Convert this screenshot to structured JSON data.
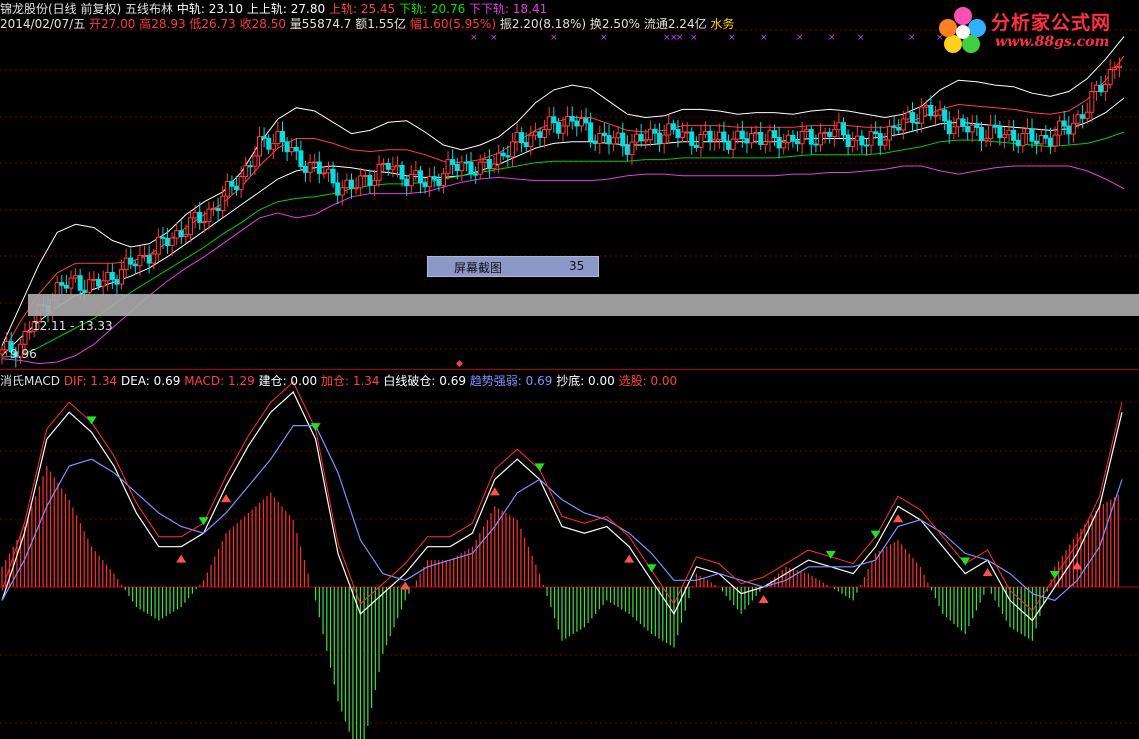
{
  "header": {
    "stock_name": "锦龙股份(日线 前复权)",
    "indicator": "五线布林",
    "mid_label": "中轨: 23.10",
    "upper_label": "上上轨: 27.80",
    "upper2_label": "上轨: 25.45",
    "lower_label": "下轨: 20.76",
    "lower2_label": "下下轨: 18.41"
  },
  "quote": {
    "date": "2014/02/07/五",
    "open": "开27.00",
    "high": "高28.93",
    "low": "低26.73",
    "close": "收28.50",
    "volume": "量55874.7",
    "amount": "额1.55亿",
    "change": "幅1.60(5.95%)",
    "amplitude": "振2.20(8.18%)",
    "turnover": "换2.50%",
    "float": "流通2.24亿",
    "sector": "水务"
  },
  "macd_header": {
    "name": "消氏MACD",
    "dif": "DIF: 1.34",
    "dea": "DEA: 0.69",
    "macd": "MACD: 1.29",
    "build": "建仓: 0.00",
    "add": "加仓: 1.34",
    "white_lock": "白线破仓: 0.69",
    "trend": "趋势强弱: 0.69",
    "bottom": "抄底: 0.00",
    "pick": "选股: 0.00"
  },
  "logo": {
    "title": "分析家公式网",
    "url": "www.88gs.com"
  },
  "tooltip": {
    "label": "屏幕截图",
    "value": "35"
  },
  "range_label": "12.11 - 13.33",
  "low_label": "9.96",
  "colors": {
    "up": "#ff3b3b",
    "down": "#00e0e0",
    "upper2": "#ffffff",
    "upper": "#ff4040",
    "mid": "#ffffff",
    "lower": "#00d000",
    "lower2": "#e040e0",
    "dif": "#ffffff",
    "dea": "#7f8fff",
    "bar_up": "#ff3030",
    "bar_down": "#40e040"
  },
  "chart_data": [
    {
      "type": "candlestick",
      "title": "五线布林",
      "ylim": [
        9.5,
        30
      ],
      "series": [
        {
          "name": "上上轨",
          "values": [
            10.5,
            13,
            15.5,
            17.5,
            18,
            17.8,
            17,
            16.6,
            16.8,
            17.5,
            18.6,
            19.4,
            20,
            21.2,
            23,
            24.5,
            25.2,
            25,
            24.3,
            23.6,
            23.8,
            24.3,
            24.4,
            23.7,
            22.9,
            22.6,
            22.9,
            23.4,
            24.3,
            25.5,
            26.3,
            26.6,
            26.4,
            25.6,
            24.8,
            24.6,
            24.7,
            25.1,
            25.1,
            25,
            24.8,
            24.9,
            24.9,
            24.8,
            25,
            25.1,
            25,
            24.8,
            24.6,
            24.8,
            25.3,
            26.3,
            26.9,
            26.8,
            26.6,
            26.5,
            26.1,
            25.9,
            26.2,
            27,
            28.2,
            29.6
          ]
        },
        {
          "name": "上轨",
          "values": [
            10,
            12,
            13.7,
            15,
            15.6,
            15.6,
            15.6,
            15.7,
            16.1,
            16.9,
            17.8,
            18.6,
            19.3,
            20.3,
            21.6,
            22.7,
            23.3,
            23.3,
            23,
            22.6,
            22.5,
            22.6,
            22.6,
            22.3,
            21.9,
            21.8,
            22,
            22.4,
            23.1,
            23.8,
            24.3,
            24.6,
            24.6,
            24.2,
            23.8,
            23.7,
            23.8,
            24.1,
            24.1,
            24.1,
            24,
            24,
            24,
            24,
            24.1,
            24.1,
            24.1,
            24,
            24,
            24.2,
            24.6,
            25.1,
            25.4,
            25.3,
            25.2,
            25.1,
            24.9,
            24.8,
            25,
            25.7,
            26.9,
            28.4
          ]
        },
        {
          "name": "中轨",
          "values": [
            9.9,
            11,
            12,
            12.9,
            13.6,
            14,
            14.4,
            14.8,
            15.3,
            16,
            16.8,
            17.6,
            18.4,
            19.2,
            20,
            20.8,
            21.3,
            21.5,
            21.6,
            21.5,
            21.3,
            21.2,
            21,
            20.9,
            20.9,
            21,
            21.3,
            21.7,
            22.2,
            22.7,
            23,
            23.1,
            23.1,
            23,
            22.9,
            22.9,
            23,
            23.1,
            23.1,
            23.1,
            23.1,
            23.1,
            23.1,
            23.2,
            23.3,
            23.3,
            23.3,
            23.3,
            23.4,
            23.6,
            23.9,
            24.2,
            24.3,
            24.2,
            24.1,
            24,
            23.9,
            23.8,
            23.9,
            24.3,
            24.9,
            25.8
          ]
        },
        {
          "name": "下轨",
          "values": [
            9.8,
            9.9,
            10.4,
            11,
            11.6,
            12.2,
            13,
            13.8,
            14.5,
            15.2,
            15.9,
            16.6,
            17.4,
            18.1,
            18.9,
            19.4,
            19.6,
            19.7,
            19.9,
            20.2,
            20.4,
            20.5,
            20.5,
            20.6,
            20.8,
            21,
            21.2,
            21.4,
            21.6,
            21.8,
            21.9,
            21.9,
            21.9,
            21.9,
            21.9,
            22,
            22,
            22.1,
            22.1,
            22.1,
            22.1,
            22.1,
            22.1,
            22.2,
            22.3,
            22.3,
            22.3,
            22.3,
            22.4,
            22.6,
            22.8,
            23.1,
            23.2,
            23.2,
            23.1,
            23,
            22.9,
            22.8,
            22.9,
            23,
            23.3,
            23.7
          ]
        },
        {
          "name": "下下轨",
          "values": [
            9.7,
            9.6,
            9.4,
            9.5,
            9.9,
            10.6,
            11.6,
            12.6,
            13.6,
            14.5,
            15.3,
            16,
            16.8,
            17.6,
            18.4,
            18.7,
            18.4,
            18.6,
            19.2,
            19.7,
            19.9,
            19.9,
            19.9,
            20,
            20.3,
            20.6,
            20.8,
            20.9,
            20.8,
            20.7,
            20.7,
            20.7,
            20.7,
            20.8,
            21,
            21.1,
            21.1,
            21,
            21,
            21,
            21,
            21,
            21,
            21.1,
            21.1,
            21.2,
            21.2,
            21.3,
            21.4,
            21.6,
            21.6,
            21.3,
            21.1,
            21.3,
            21.5,
            21.6,
            21.6,
            21.6,
            21.6,
            21.3,
            20.8,
            20.2
          ]
        }
      ],
      "candles_close": [
        10,
        10.6,
        12.5,
        14,
        14.5,
        14.2,
        14.8,
        15.5,
        16.2,
        17,
        17.8,
        18.5,
        19.6,
        21,
        22.8,
        23.5,
        22,
        21.6,
        20.6,
        20.2,
        21,
        21.6,
        21,
        20.5,
        21.2,
        21.8,
        21.3,
        22.2,
        23,
        23.6,
        24.1,
        24.5,
        23.6,
        23.2,
        23,
        23.3,
        23.8,
        23.5,
        23.2,
        23.4,
        23.1,
        23.6,
        23,
        23.4,
        23.2,
        23.8,
        23.4,
        23,
        23.6,
        24.2,
        25.1,
        24.6,
        24,
        23.8,
        23.6,
        23.5,
        23.2,
        23.4,
        24,
        25.2,
        27,
        28.5
      ]
    },
    {
      "type": "bar",
      "title": "消氏MACD",
      "ylim": [
        -2.9,
        2.9
      ],
      "series": [
        {
          "name": "DIF",
          "values": [
            -0.2,
            0.8,
            2.2,
            2.6,
            2.3,
            1.8,
            1.1,
            0.6,
            0.6,
            0.8,
            1.5,
            2.1,
            2.6,
            2.9,
            2.2,
            0.5,
            -0.4,
            -0.1,
            0.2,
            0.6,
            0.6,
            0.8,
            1.6,
            1.9,
            1.6,
            0.9,
            0.8,
            0.9,
            0.6,
            0.1,
            -0.4,
            0.3,
            0.2,
            -0.1,
            0,
            0.2,
            0.4,
            0.3,
            0.2,
            0.6,
            1.2,
            1.0,
            0.6,
            0.2,
            0.4,
            -0.2,
            -0.5,
            0,
            0.5,
            1.2,
            2.6
          ]
        },
        {
          "name": "DEA",
          "values": [
            -0.2,
            0.4,
            1.2,
            1.8,
            1.9,
            1.7,
            1.4,
            1.1,
            0.9,
            0.8,
            1.1,
            1.5,
            1.9,
            2.4,
            2.4,
            1.7,
            0.7,
            0.2,
            0.1,
            0.3,
            0.4,
            0.5,
            0.9,
            1.4,
            1.6,
            1.3,
            1.1,
            1.0,
            0.8,
            0.5,
            0.1,
            0.1,
            0.2,
            0.1,
            0,
            0.1,
            0.3,
            0.3,
            0.3,
            0.4,
            0.9,
            1.0,
            0.8,
            0.5,
            0.4,
            0.2,
            -0.1,
            -0.2,
            0.1,
            0.6,
            1.6
          ]
        },
        {
          "name": "MACD",
          "values": [
            0.3,
            0.9,
            1.8,
            1.3,
            0.6,
            0.2,
            -0.3,
            -0.5,
            -0.3,
            0.1,
            0.8,
            1.1,
            1.4,
            1.0,
            -0.2,
            -1.7,
            -2.6,
            -1.0,
            -0.2,
            0.4,
            0.4,
            0.6,
            1.2,
            1.0,
            0.2,
            -0.8,
            -0.6,
            -0.2,
            -0.4,
            -0.7,
            -0.9,
            0.2,
            0,
            -0.4,
            0,
            0.3,
            0.2,
            0,
            -0.2,
            0.5,
            0.7,
            0.3,
            -0.4,
            -0.7,
            0,
            -0.6,
            -0.8,
            0.3,
            0.8,
            1.2,
            1.4
          ]
        }
      ],
      "markers": [
        "建仓",
        "加仓",
        "白线破仓",
        "抄底"
      ]
    }
  ]
}
